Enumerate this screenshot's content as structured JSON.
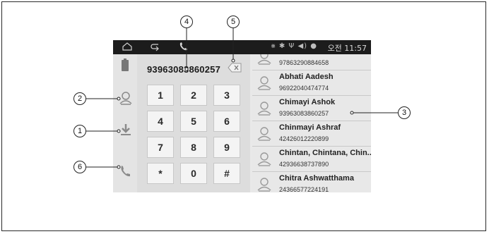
{
  "status_bar": {
    "time": "오전 11:57",
    "icons": [
      "mute-icon",
      "bluetooth-icon",
      "usb-icon",
      "volume-icon",
      "location-icon"
    ]
  },
  "dialer": {
    "number": "93963083860257",
    "keys": [
      "1",
      "2",
      "3",
      "4",
      "5",
      "6",
      "7",
      "8",
      "9",
      "*",
      "0",
      "#"
    ]
  },
  "contacts": [
    {
      "name": "",
      "number": "97863290884658"
    },
    {
      "name": "Abhati Aadesh",
      "number": "96922040474774"
    },
    {
      "name": "Chimayi Ashok",
      "number": "93963083860257"
    },
    {
      "name": "Chinmayi Ashraf",
      "number": "42426012220899"
    },
    {
      "name": "Chintan, Chintana, Chin...",
      "number": "42936638737890"
    },
    {
      "name": "Chitra Ashwatthama",
      "number": "24366577224191"
    }
  ],
  "callouts": [
    "1",
    "2",
    "3",
    "4",
    "5",
    "6"
  ]
}
